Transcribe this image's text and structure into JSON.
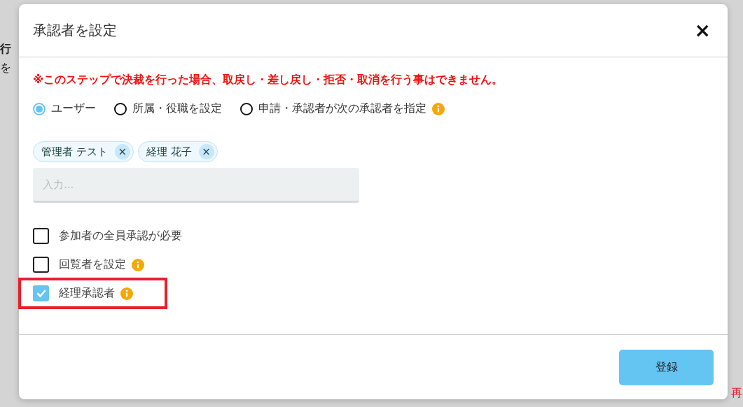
{
  "background": {
    "texts": [
      {
        "text": "行",
        "kind": "bold"
      },
      {
        "text": "を",
        "kind": "plain"
      }
    ],
    "side_note": "再"
  },
  "dialog": {
    "title": "承認者を設定",
    "close": "×",
    "warning": "※このステップで決裁を行った場合、取戻し・差し戻し・拒否・取消を行う事はできません。",
    "radios": [
      {
        "label": "ユーザー",
        "selected": true,
        "info": false
      },
      {
        "label": "所属・役職を設定",
        "selected": false,
        "info": false
      },
      {
        "label": "申請・承認者が次の承認者を指定",
        "selected": false,
        "info": true
      }
    ],
    "chips": [
      {
        "label": "管理者 テスト",
        "remove": "×"
      },
      {
        "label": "経理 花子",
        "remove": "×"
      }
    ],
    "input": {
      "placeholder": "入力..."
    },
    "checkboxes": [
      {
        "label": "参加者の全員承認が必要",
        "checked": false,
        "info": false,
        "highlighted": false
      },
      {
        "label": "回覧者を設定",
        "checked": false,
        "info": true,
        "highlighted": false
      },
      {
        "label": "経理承認者",
        "checked": true,
        "info": true,
        "highlighted": true
      }
    ],
    "submit": "登録"
  }
}
